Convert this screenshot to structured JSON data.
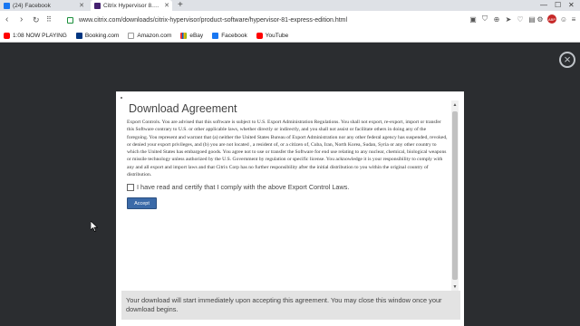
{
  "tabs": [
    {
      "title": "(24) Facebook",
      "icon": "facebook-icon"
    },
    {
      "title": "Citrix Hypervisor 8.1 Express",
      "icon": "citrix-icon"
    }
  ],
  "toolbar": {
    "url": "www.citrix.com/downloads/citrix-hypervisor/product-software/hypervisor-81-express-edition.html",
    "extension_badge": "ABP"
  },
  "bookmarks": [
    {
      "label": "1:08 NOW PLAYING",
      "icon": "youtube-icon"
    },
    {
      "label": "Booking.com",
      "icon": "booking-icon"
    },
    {
      "label": "Amazon.com",
      "icon": "amazon-icon"
    },
    {
      "label": "eBay",
      "icon": "ebay-icon"
    },
    {
      "label": "Facebook",
      "icon": "facebook-icon"
    },
    {
      "label": "YouTube",
      "icon": "youtube-icon"
    }
  ],
  "modal": {
    "title": "Download Agreement",
    "body": "Export Controls. You are advised that this software is subject to U.S. Export Administration Regulations. You shall not export, re-export, import or transfer this Software contrary to U.S. or other applicable laws, whether directly or indirectly, and you shall not assist or facilitate others in doing any of the foregoing. You represent and warrant that (a) neither the United States Bureau of Export Administration nor any other federal agency has suspended, revoked, or denied your export privileges, and (b) you are not located , a resident of, or a citizen of, Cuba, Iran, North Korea, Sudan, Syria or any other country to which the United States has embargoed goods. You agree not to use or transfer the Software for end use relating to any nuclear, chemical, biological weapons or missile technology unless authorized by the U.S. Government by regulation or specific license. You acknowledge it is your responsibility to comply with any and all export and import laws and that Citrix Corp has no further responsibility after the initial distribution to you within the original country of distribution.",
    "checkbox_label": "I have read and certify that I comply with the above Export Control Laws.",
    "accept_label": "Accept",
    "footer_text": "Your download will start immediately upon accepting this agreement. You may close this window once your download begins."
  },
  "colors": {
    "overlay": "#2b2d30",
    "accept_button": "#3b6aa8",
    "footer_bg": "#e3e3e3"
  }
}
